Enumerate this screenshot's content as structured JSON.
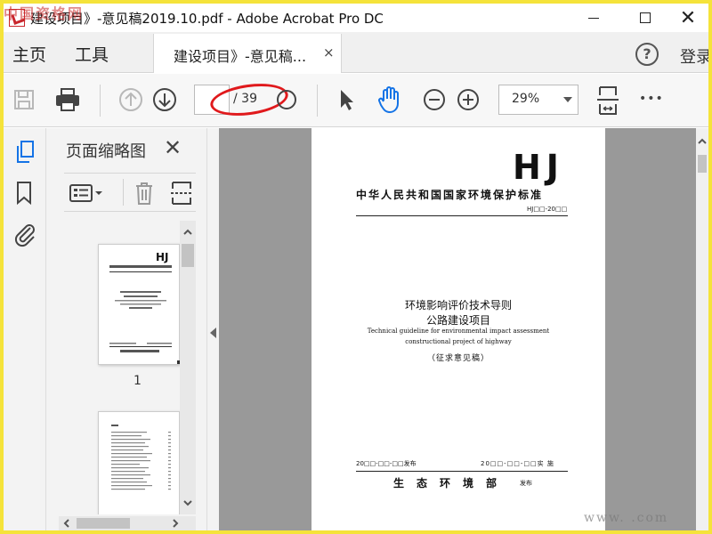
{
  "window": {
    "title": "建设项目》-意见稿2019.10.pdf - Adobe Acrobat Pro DC",
    "close_glyph": "✕"
  },
  "nav": {
    "home_label": "主页",
    "tools_label": "工具",
    "doc_tab_label": "建设项目》-意见稿...",
    "doc_tab_close": "×",
    "help_glyph": "?",
    "login_label": "登录"
  },
  "toolbar": {
    "page_current": "",
    "page_total": "/ 39",
    "zoom_value": "29%",
    "more_glyph": "•••",
    "highlight_color": "#e0191c"
  },
  "left_rail": {
    "icons": [
      "pages-icon",
      "bookmark-icon",
      "attachment-icon"
    ],
    "active_color": "#1473e6"
  },
  "thumbnail_panel": {
    "title": "页面缩略图",
    "close_glyph": "✕",
    "page1_label": "1"
  },
  "pdf": {
    "logo": "HJ",
    "standard_name": "中华人民共和国国家环境保护标准",
    "code": "HJ□□-20□□",
    "title_line1": "环境影响评价技术导则",
    "title_line2": "公路建设项目",
    "title_en1": "Technical guideline for environmental impact assessment",
    "title_en2": "constructional project of highway",
    "draft_note": "（征求意见稿）",
    "issue_date": "20□□-□□-□□发布",
    "impl_date": "20□□-□□-□□实 施",
    "ministry": "生态环境部",
    "release": "发布"
  },
  "watermarks": {
    "top": "中国资格网",
    "bottom": "www.  .com"
  }
}
